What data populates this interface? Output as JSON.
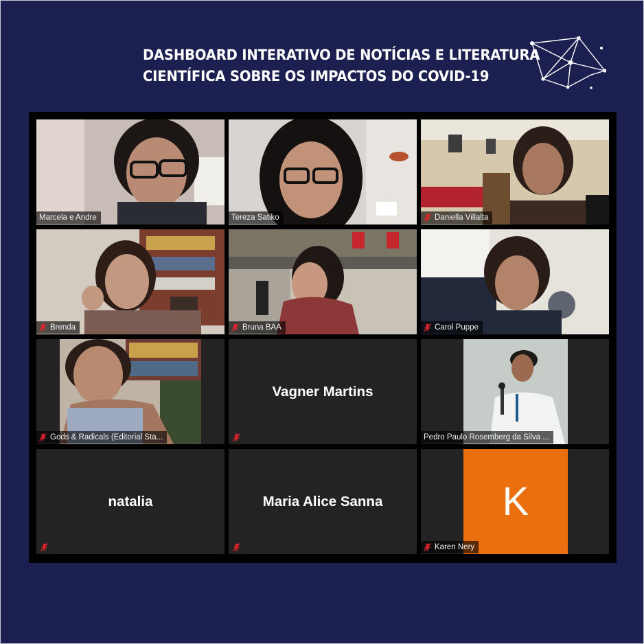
{
  "header": {
    "title_line1": "DASHBOARD INTERATIVO DE NOTÍCIAS E LITERATURA",
    "title_line2": "CIENTÍFICA SOBRE OS IMPACTOS DO COVID-19",
    "logo_icon": "network-constellation-icon"
  },
  "colors": {
    "background": "#1b2050",
    "tile": "#232323",
    "active_speaker_border": "#c9db5a",
    "muted_icon": "#e0252b",
    "avatar_orange": "#ec6f0f"
  },
  "participants": [
    {
      "name": "Marcela e Andre",
      "muted": false,
      "video": true
    },
    {
      "name": "Tereza Satiko",
      "muted": false,
      "video": true,
      "active_speaker": true
    },
    {
      "name": "Daniella Villalta",
      "muted": true,
      "video": true
    },
    {
      "name": "Brenda",
      "muted": true,
      "video": true
    },
    {
      "name": "Bruna BAA",
      "muted": true,
      "video": true
    },
    {
      "name": "Carol Puppe",
      "muted": true,
      "video": true
    },
    {
      "name": "Gods & Radicals (Editorial Sta...",
      "muted": true,
      "video": true
    },
    {
      "name": "Vagner Martins",
      "muted": true,
      "video": false
    },
    {
      "name": "Pedro Paulo Rosemberg da Silva ...",
      "muted": false,
      "video": true
    },
    {
      "name": "natalia",
      "muted": true,
      "video": false
    },
    {
      "name": "Maria Alice Sanna",
      "muted": true,
      "video": false
    },
    {
      "name": "Karen Nery",
      "muted": true,
      "video": false,
      "avatar_letter": "K"
    }
  ]
}
